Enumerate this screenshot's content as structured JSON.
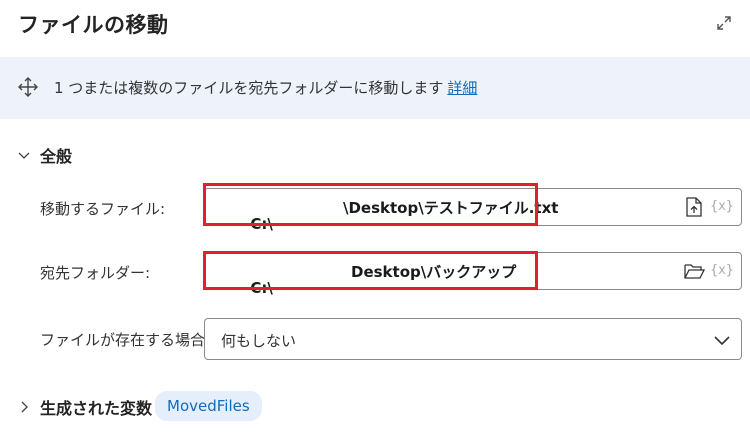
{
  "dialog": {
    "title": "ファイルの移動"
  },
  "info": {
    "description": "1 つまたは複数のファイルを宛先フォルダーに移動します",
    "link_label": "詳細"
  },
  "general": {
    "label": "全般"
  },
  "fields": {
    "files_to_move": {
      "label": "移動するファイル:",
      "value_prefix": "C:\\",
      "value_suffix": "\\Desktop\\テストファイル.txt"
    },
    "destination": {
      "label": "宛先フォルダー:",
      "value_prefix": "C:\\",
      "value_suffix": "Desktop\\バックアップ"
    },
    "if_exists": {
      "label": "ファイルが存在する場合:",
      "value": "何もしない"
    },
    "variable_button_label": "{x}"
  },
  "variables": {
    "label": "生成された変数",
    "chip": "MovedFiles"
  },
  "colors": {
    "accent": "#0f6cbd",
    "highlight": "#e0202e",
    "info_background": "#eef3fb"
  },
  "icons": [
    "expand-icon",
    "move-icon",
    "chevron-down-icon",
    "file-upload-icon",
    "folder-open-icon",
    "chevron-right-icon"
  ]
}
